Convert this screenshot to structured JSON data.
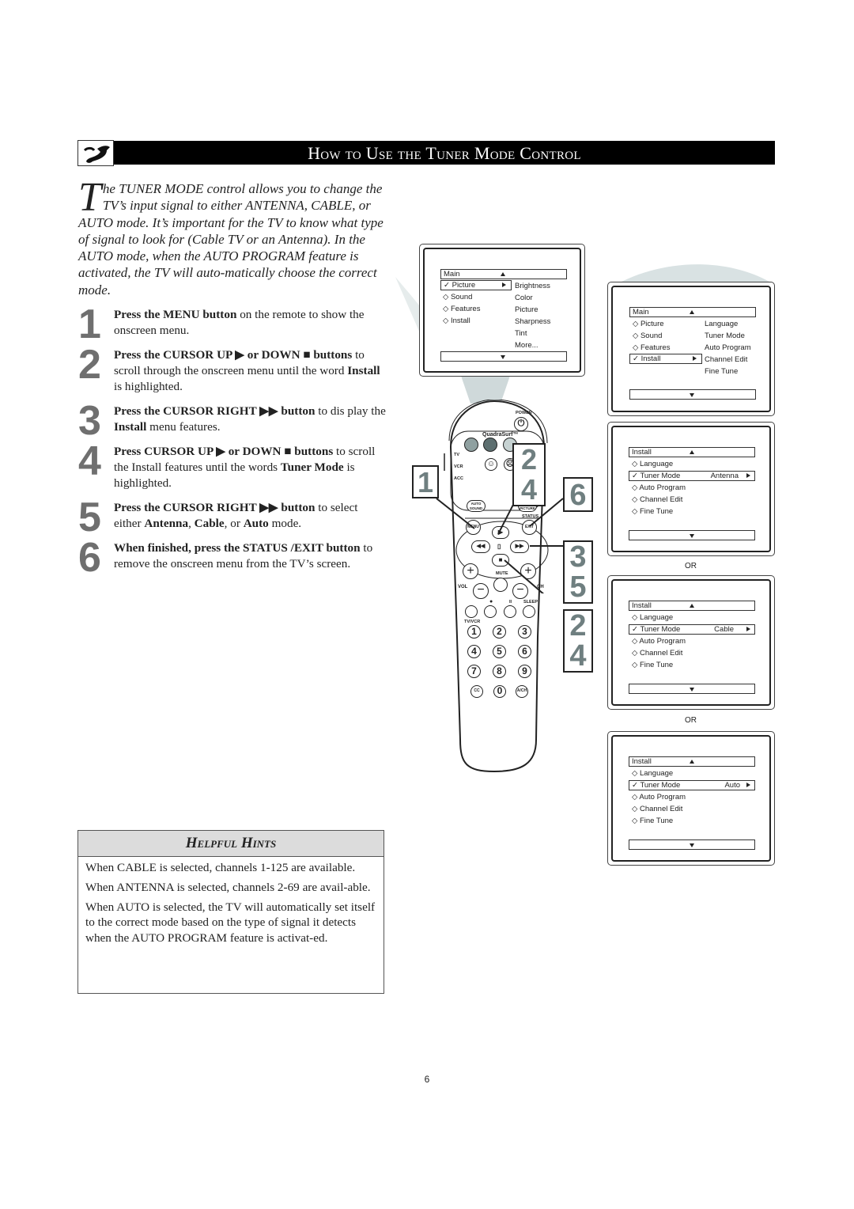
{
  "header": {
    "icon": "satellite-dish-icon",
    "title": "How to Use the Tuner Mode Control"
  },
  "intro": {
    "dropcap": "T",
    "text": "he TUNER MODE control allows you to change the TV’s input signal to either ANTENNA, CABLE, or AUTO mode. It’s important for the TV to know what type of signal to look for (Cable TV or an Antenna). In the AUTO mode, when the AUTO PROGRAM feature is activated, the TV will auto-matically choose the correct mode."
  },
  "steps": [
    {
      "num": "1",
      "bold": "Press the MENU button",
      "rest": " on the remote to show the onscreen menu."
    },
    {
      "num": "2",
      "bold": "Press the CURSOR UP ▶ or DOWN ■ buttons",
      "rest": " to scroll through the onscreen menu until the word ",
      "bold2": "Install",
      "rest2": " is highlighted."
    },
    {
      "num": "3",
      "bold": "Press the CURSOR RIGHT ▶▶ button",
      "rest": " to dis play the ",
      "bold2": "Install",
      "rest2": " menu features."
    },
    {
      "num": "4",
      "bold": "Press CURSOR UP ▶ or DOWN ■ buttons",
      "rest": " to scroll the Install features until the words ",
      "bold2": "Tuner Mode",
      "rest2": " is highlighted."
    },
    {
      "num": "5",
      "bold": "Press the CURSOR RIGHT ▶▶ button",
      "rest": " to select either ",
      "bold2": "Antenna",
      "rest2": ", ",
      "bold3": "Cable",
      "rest3": ", or ",
      "bold4": "Auto",
      "rest4": " mode."
    },
    {
      "num": "6",
      "bold": "When finished, press the STATUS /EXIT button",
      "rest": " to remove the onscreen menu from the TV’s screen."
    }
  ],
  "hints": {
    "title": "Helpful Hints",
    "items": [
      "When CABLE is selected, channels 1-125 are available.",
      "When ANTENNA is selected, channels 2-69 are avail-able.",
      "When AUTO is selected, the TV will automatically set itself to the correct mode based on the type of signal it detects when the AUTO PROGRAM feature is activat-ed."
    ]
  },
  "screens": {
    "main_picture": {
      "title": "Main",
      "left": [
        "Picture",
        "Sound",
        "Features",
        "Install"
      ],
      "selected": "Picture",
      "right": [
        "Brightness",
        "Color",
        "Picture",
        "Sharpness",
        "Tint",
        "More..."
      ]
    },
    "main_install": {
      "title": "Main",
      "left": [
        "Picture",
        "Sound",
        "Features",
        "Install"
      ],
      "selected": "Install",
      "right": [
        "Language",
        "Tuner Mode",
        "Auto Program",
        "Channel Edit",
        "Fine Tune"
      ]
    },
    "install_antenna": {
      "title": "Install",
      "items": [
        "Language",
        "Tuner Mode",
        "Auto Program",
        "Channel Edit",
        "Fine Tune"
      ],
      "selected": "Tuner Mode",
      "value": "Antenna"
    },
    "install_cable": {
      "title": "Install",
      "items": [
        "Language",
        "Tuner Mode",
        "Auto Program",
        "Channel Edit",
        "Fine Tune"
      ],
      "selected": "Tuner Mode",
      "value": "Cable"
    },
    "install_auto": {
      "title": "Install",
      "items": [
        "Language",
        "Tuner Mode",
        "Auto Program",
        "Channel Edit",
        "Fine Tune"
      ],
      "selected": "Tuner Mode",
      "value": "Auto"
    },
    "or_label": "OR"
  },
  "remote": {
    "power": "POWER",
    "brand": "QuadraSurf™",
    "switch": [
      "TV",
      "VCR",
      "ACC"
    ],
    "auto_sound": "AUTO SOUND",
    "auto_picture": "AUTO PICTURE",
    "menu": "MENU",
    "status": "STATUS",
    "exit": "EXIT",
    "mute": "MUTE",
    "vol": "VOL",
    "ch": "CH",
    "sleep": "SLEEP",
    "tvvcr": "TV/VCR",
    "digits": [
      "1",
      "2",
      "3",
      "4",
      "5",
      "6",
      "7",
      "8",
      "9"
    ],
    "cc": "CC",
    "zero": "0",
    "ach": "A/CH",
    "callouts": {
      "left": "1",
      "mid": "2\n4",
      "right": "6",
      "ff": "3\n5",
      "down": "2\n4"
    }
  },
  "page_number": "6",
  "colors": {
    "step_number": "#6f6f6f",
    "callout_number": "#6f7f80",
    "hints_header": "#dcdcdc",
    "beam": "#cfd9da"
  }
}
